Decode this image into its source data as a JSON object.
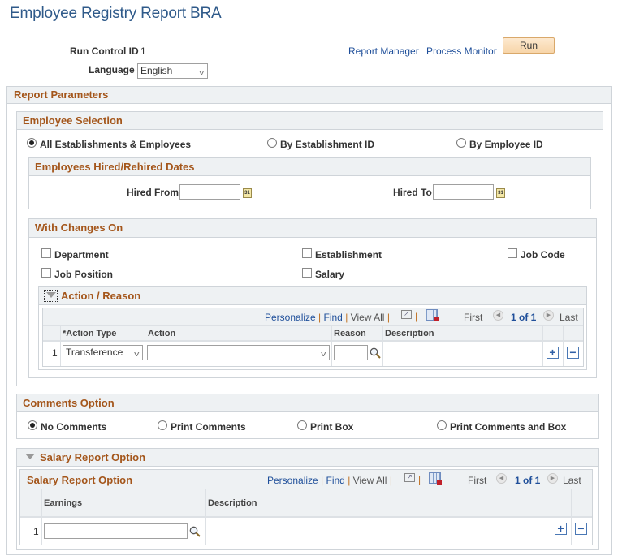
{
  "page": {
    "title": "Employee Registry Report BRA",
    "run_control_label": "Run Control ID",
    "run_control_value": "1",
    "language_label": "Language",
    "language_value": "English",
    "links": {
      "report_manager": "Report Manager",
      "process_monitor": "Process Monitor"
    },
    "run_button": "Run"
  },
  "report_parameters": {
    "header": "Report Parameters",
    "employee_selection": {
      "header": "Employee Selection",
      "options": [
        {
          "label": "All Establishments & Employees",
          "selected": true
        },
        {
          "label": "By Establishment ID",
          "selected": false
        },
        {
          "label": "By Employee ID",
          "selected": false
        }
      ],
      "hired_dates": {
        "header": "Employees Hired/Rehired Dates",
        "hired_from_label": "Hired From",
        "hired_from_value": "",
        "hired_to_label": "Hired To",
        "hired_to_value": ""
      }
    },
    "with_changes_on": {
      "header": "With Changes On",
      "checkboxes": [
        {
          "label": "Department",
          "checked": false
        },
        {
          "label": "Establishment",
          "checked": false
        },
        {
          "label": "Job Code",
          "checked": false
        },
        {
          "label": "Job Position",
          "checked": false
        },
        {
          "label": "Salary",
          "checked": false
        }
      ],
      "action_reason": {
        "header": "Action / Reason",
        "toolbar": {
          "personalize": "Personalize",
          "find": "Find",
          "view_all": "View All",
          "first": "First",
          "count": "1 of 1",
          "last": "Last"
        },
        "columns": [
          "*Action Type",
          "Action",
          "Reason",
          "Description"
        ],
        "rows": [
          {
            "num": "1",
            "action_type": "Transference",
            "action": "",
            "reason": "",
            "description": ""
          }
        ]
      }
    },
    "comments_option": {
      "header": "Comments Option",
      "options": [
        {
          "label": "No Comments",
          "selected": true
        },
        {
          "label": "Print Comments",
          "selected": false
        },
        {
          "label": "Print Box",
          "selected": false
        },
        {
          "label": "Print Comments and Box",
          "selected": false
        }
      ]
    },
    "salary_report_option": {
      "header": "Salary Report Option",
      "grid_title": "Salary Report Option",
      "toolbar": {
        "personalize": "Personalize",
        "find": "Find",
        "view_all": "View All",
        "first": "First",
        "count": "1 of 1",
        "last": "Last"
      },
      "columns": [
        "Earnings",
        "Description"
      ],
      "rows": [
        {
          "num": "1",
          "earnings": "",
          "description": ""
        }
      ]
    }
  },
  "colors": {
    "header_text": "#a4561b",
    "link": "#1f4f9a",
    "title": "#2f5a8a",
    "run_button": "#f7d5a9"
  }
}
